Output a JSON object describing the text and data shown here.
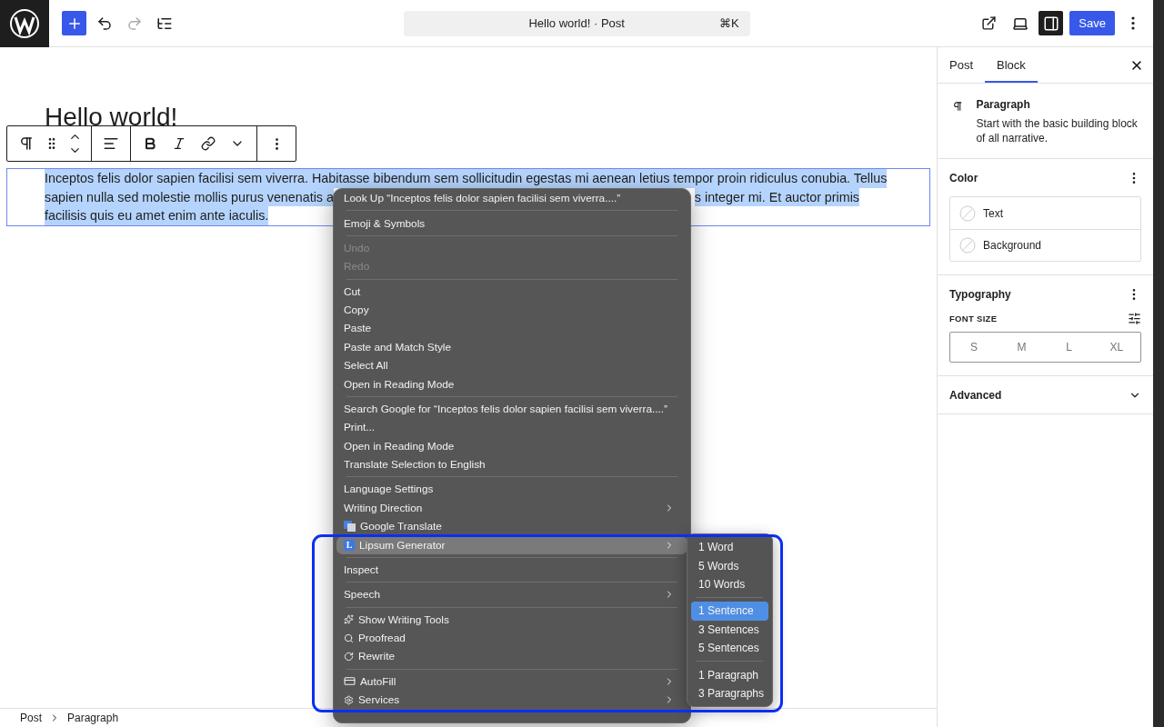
{
  "topbar": {
    "undo_disabled": false,
    "redo_disabled": true,
    "command_title": "Hello world! · Post",
    "shortcut": "⌘K",
    "sidebar_on": true,
    "save": "Save"
  },
  "editor": {
    "title": "Hello world!",
    "lines": [
      {
        "left": "Inceptos felis dolor sapien facilisi sem viverra. Habitasse bibendum sem sollicitudin egestas mi aenean letius tempor proin ridiculus conubia. Tellus"
      },
      {
        "left": "sapien nulla sed molestie mollis purus venenatis a",
        "right": "s integer mi. Et auctor primis"
      },
      {
        "left": "facilisis quis eu amet enim ante iaculis."
      }
    ]
  },
  "context_menu": {
    "groups": [
      [
        {
          "label": "Look Up “Inceptos felis dolor sapien facilisi sem viverra....”",
          "kind": "plain",
          "disabled": false,
          "submenu": false,
          "selected": false
        }
      ],
      [
        {
          "label": "Emoji & Symbols",
          "kind": "plain",
          "disabled": false,
          "submenu": false,
          "selected": false
        }
      ],
      [
        {
          "label": "Undo",
          "kind": "plain",
          "disabled": true,
          "submenu": false,
          "selected": false
        },
        {
          "label": "Redo",
          "kind": "plain",
          "disabled": true,
          "submenu": false,
          "selected": false
        }
      ],
      [
        {
          "label": "Cut",
          "kind": "plain",
          "disabled": false,
          "submenu": false,
          "selected": false
        },
        {
          "label": "Copy",
          "kind": "plain",
          "disabled": false,
          "submenu": false,
          "selected": false
        },
        {
          "label": "Paste",
          "kind": "plain",
          "disabled": false,
          "submenu": false,
          "selected": false
        },
        {
          "label": "Paste and Match Style",
          "kind": "plain",
          "disabled": false,
          "submenu": false,
          "selected": false
        },
        {
          "label": "Select All",
          "kind": "plain",
          "disabled": false,
          "submenu": false,
          "selected": false
        },
        {
          "label": "Open in Reading Mode",
          "kind": "plain",
          "disabled": false,
          "submenu": false,
          "selected": false
        }
      ],
      [
        {
          "label": "Search Google for “Inceptos felis dolor sapien facilisi sem viverra....”",
          "kind": "plain",
          "disabled": false,
          "submenu": false,
          "selected": false
        },
        {
          "label": "Print...",
          "kind": "plain",
          "disabled": false,
          "submenu": false,
          "selected": false
        },
        {
          "label": "Open in Reading Mode",
          "kind": "plain",
          "disabled": false,
          "submenu": false,
          "selected": false
        },
        {
          "label": "Translate Selection to English",
          "kind": "plain",
          "disabled": false,
          "submenu": false,
          "selected": false
        }
      ],
      [
        {
          "label": "Language Settings",
          "kind": "plain",
          "disabled": false,
          "submenu": false,
          "selected": false
        },
        {
          "label": "Writing Direction",
          "kind": "plain",
          "disabled": false,
          "submenu": true,
          "selected": false
        },
        {
          "label": "Google Translate",
          "kind": "translate",
          "disabled": false,
          "submenu": false,
          "selected": false
        },
        {
          "label": "Lipsum Generator",
          "kind": "letter",
          "badge": "L",
          "disabled": false,
          "submenu": true,
          "selected": true
        }
      ],
      [
        {
          "label": "Inspect",
          "kind": "plain",
          "disabled": false,
          "submenu": false,
          "selected": false
        }
      ],
      [
        {
          "label": "Speech",
          "kind": "plain",
          "disabled": false,
          "submenu": true,
          "selected": false
        }
      ],
      [
        {
          "label": "Show Writing Tools",
          "kind": "sparkle",
          "disabled": false,
          "submenu": false,
          "selected": false
        },
        {
          "label": "Proofread",
          "kind": "magnifier",
          "disabled": false,
          "submenu": false,
          "selected": false
        },
        {
          "label": "Rewrite",
          "kind": "cycle",
          "disabled": false,
          "submenu": false,
          "selected": false
        }
      ],
      [
        {
          "label": "AutoFill",
          "kind": "card",
          "disabled": false,
          "submenu": true,
          "selected": false
        },
        {
          "label": "Services",
          "kind": "gear",
          "disabled": false,
          "submenu": true,
          "selected": false
        }
      ]
    ]
  },
  "submenu": {
    "groups": [
      [
        {
          "label": "1 Word",
          "selected": false
        },
        {
          "label": "5 Words",
          "selected": false
        },
        {
          "label": "10 Words",
          "selected": false
        }
      ],
      [
        {
          "label": "1 Sentence",
          "selected": true
        },
        {
          "label": "3 Sentences",
          "selected": false
        },
        {
          "label": "5 Sentences",
          "selected": false
        }
      ],
      [
        {
          "label": "1 Paragraph",
          "selected": false
        },
        {
          "label": "3 Paragraphs",
          "selected": false
        }
      ]
    ]
  },
  "sidebar": {
    "tabs": [
      {
        "label": "Post",
        "selected": false
      },
      {
        "label": "Block",
        "selected": true
      }
    ],
    "block": {
      "name": "Paragraph",
      "description": "Start with the basic building block of all narrative."
    },
    "color": {
      "title": "Color",
      "items": [
        {
          "label": "Text"
        },
        {
          "label": "Background"
        }
      ]
    },
    "typography": {
      "title": "Typography",
      "font_size_label": "FONT SIZE",
      "sizes": [
        {
          "label": "S",
          "selected": false
        },
        {
          "label": "M",
          "selected": false
        },
        {
          "label": "L",
          "selected": false
        },
        {
          "label": "XL",
          "selected": false
        }
      ]
    },
    "advanced": {
      "title": "Advanced",
      "expanded": false
    }
  },
  "breadcrumb": [
    "Post",
    "Paragraph"
  ]
}
